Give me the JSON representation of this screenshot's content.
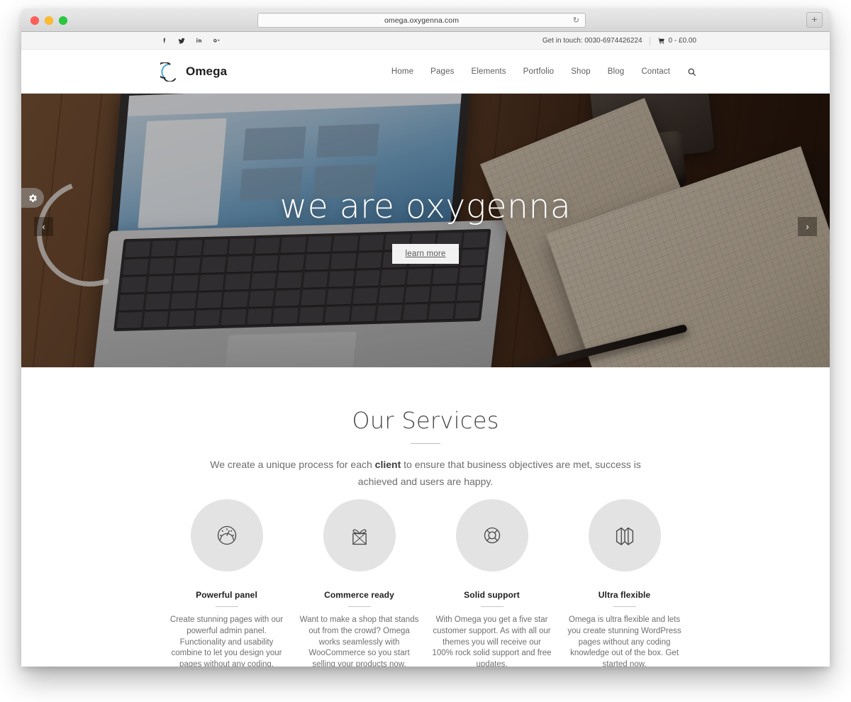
{
  "browser": {
    "url": "omega.oxygenna.com",
    "reload_icon": "reload-icon",
    "new_tab_label": "+",
    "traffic_lights": [
      "close",
      "minimize",
      "maximize"
    ]
  },
  "topbar": {
    "social": [
      {
        "name": "facebook",
        "glyph": "f"
      },
      {
        "name": "twitter",
        "glyph": "t"
      },
      {
        "name": "linkedin",
        "glyph": "in"
      },
      {
        "name": "googleplus",
        "glyph": "G+"
      }
    ],
    "contact_text": "Get in touch: 0030-6974426224",
    "cart_text": "0 - £0.00"
  },
  "header": {
    "brand_name": "Omega",
    "nav": [
      {
        "label": "Home"
      },
      {
        "label": "Pages"
      },
      {
        "label": "Elements"
      },
      {
        "label": "Portfolio"
      },
      {
        "label": "Shop"
      },
      {
        "label": "Blog"
      },
      {
        "label": "Contact"
      }
    ],
    "search_icon": "search-icon"
  },
  "hero": {
    "title": "we are oxygenna",
    "button_label": "learn more",
    "prev_label": "‹",
    "next_label": "›",
    "settings_icon": "gear-icon"
  },
  "services": {
    "title": "Our Services",
    "subtitle_before": "We create a unique process for each ",
    "subtitle_bold": "client",
    "subtitle_after": " to ensure that business objectives are met, success is achieved and users are happy.",
    "items": [
      {
        "icon": "speedometer-icon",
        "title": "Powerful panel",
        "text": "Create stunning pages with our powerful admin panel. Functionality and usability combine to let you design your pages without any coding."
      },
      {
        "icon": "gift-icon",
        "title": "Commerce ready",
        "text": "Want to make a shop that stands out from the crowd? Omega works seamlessly with WooCommerce so you start selling your products now."
      },
      {
        "icon": "lifebuoy-icon",
        "title": "Solid support",
        "text": "With Omega you get a five star customer support. As with all our themes you will receive our 100% rock solid support and free updates."
      },
      {
        "icon": "map-icon",
        "title": "Ultra flexible",
        "text": "Omega is ultra flexible and lets you create stunning WordPress pages without any coding knowledge out of the box. Get started now."
      }
    ]
  },
  "colors": {
    "accent": "#4da6d8",
    "text_dark": "#1d1d1d",
    "text_muted": "#6f6f6f",
    "circle_bg": "#e3e3e3"
  }
}
